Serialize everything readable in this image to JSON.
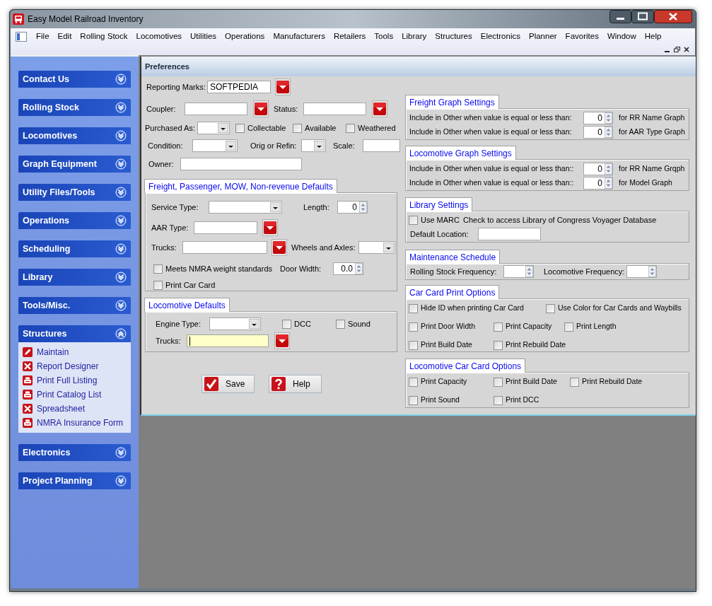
{
  "window": {
    "title": "Easy Model Railroad Inventory"
  },
  "menu": [
    "File",
    "Edit",
    "Rolling Stock",
    "Locomotives",
    "Utilities",
    "Operations",
    "Manufacturers",
    "Retailers",
    "Tools",
    "Library",
    "Structures",
    "Electronics",
    "Planner",
    "Favorites",
    "Window",
    "Help"
  ],
  "sidebar": {
    "groups": [
      {
        "title": "Contact Us",
        "expanded": false
      },
      {
        "title": "Rolling Stock",
        "expanded": false
      },
      {
        "title": "Locomotives",
        "expanded": false
      },
      {
        "title": "Graph Equipment",
        "expanded": false
      },
      {
        "title": "Utility Files/Tools",
        "expanded": false
      },
      {
        "title": "Operations",
        "expanded": false
      },
      {
        "title": "Scheduling",
        "expanded": false
      },
      {
        "title": "Library",
        "expanded": false
      },
      {
        "title": "Tools/Misc.",
        "expanded": false
      },
      {
        "title": "Structures",
        "expanded": true,
        "items": [
          {
            "label": "Maintain",
            "kind": "edit"
          },
          {
            "label": "Report Designer",
            "kind": "tools"
          },
          {
            "label": "Print Full Listing",
            "kind": "print"
          },
          {
            "label": "Print Catalog List",
            "kind": "print"
          },
          {
            "label": "Spreadsheet",
            "kind": "tools"
          },
          {
            "label": "NMRA Insurance Form",
            "kind": "print"
          }
        ]
      },
      {
        "title": "Electronics",
        "expanded": false
      },
      {
        "title": "Project Planning",
        "expanded": false
      }
    ]
  },
  "preferences": {
    "title": "Preferences",
    "reporting_marks": {
      "label": "Reporting Marks:",
      "value": "SOFTPEDIA"
    },
    "coupler": {
      "label": "Coupler:"
    },
    "status": {
      "label": "Status:"
    },
    "purchased_as": {
      "label": "Purchased As:"
    },
    "collectable": {
      "label": "Collectable",
      "checked": false
    },
    "available": {
      "label": "Available",
      "checked": false
    },
    "weathered": {
      "label": "Weathered",
      "checked": false
    },
    "condition": {
      "label": "Condition:"
    },
    "orig_or_refin": {
      "label": "Orig or Refin:"
    },
    "scale": {
      "label": "Scale:"
    },
    "owner": {
      "label": "Owner:"
    },
    "freight_defaults": {
      "title": "Freight, Passenger, MOW, Non-revenue Defaults",
      "service_type": {
        "label": "Service Type:"
      },
      "length": {
        "label": "Length:",
        "value": "0"
      },
      "aar_type": {
        "label": "AAR Type:"
      },
      "trucks": {
        "label": "Trucks:"
      },
      "wheels_and_axles": {
        "label": "Wheels and Axles:"
      },
      "meets_nmra": {
        "label": "Meets NMRA weight standards",
        "checked": false
      },
      "door_width": {
        "label": "Door Width:",
        "value": "0.0"
      },
      "print_car_card": {
        "label": "Print Car Card",
        "checked": false
      }
    },
    "locomotive_defaults": {
      "title": "Locomotive Defaults",
      "engine_type": {
        "label": "Engine Type:"
      },
      "dcc": {
        "label": "DCC",
        "checked": false
      },
      "sound": {
        "label": "Sound",
        "checked": false
      },
      "trucks": {
        "label": "Trucks:",
        "focused": true
      }
    },
    "buttons": [
      {
        "label": "Save",
        "kind": "save"
      },
      {
        "label": "Help",
        "kind": "help"
      }
    ],
    "freight_graph": {
      "title": "Freight Graph Settings",
      "rows": [
        {
          "label": "Include in Other when value is equal or less than:",
          "value": "0",
          "suffix": "for RR Name Graph"
        },
        {
          "label": "Include in Other when value is equal or less than:",
          "value": "0",
          "suffix": "for AAR Type Graph"
        }
      ]
    },
    "locomotive_graph": {
      "title": "Locomotive Graph Settings",
      "rows": [
        {
          "label": "Include in Other when value is equal or less than::",
          "value": "0",
          "suffix": "for RR Name Grqph"
        },
        {
          "label": "Include in Other when value is equal or less than::",
          "value": "0",
          "suffix": "for Model Graph"
        }
      ]
    },
    "library": {
      "title": "Library Settings",
      "use_marc": {
        "label": "Use MARC",
        "checked": false
      },
      "note": "Check to access Library of Congress Voyager Database",
      "default_location": {
        "label": "Default Location:"
      }
    },
    "maintenance": {
      "title": "Maintenance Schedule",
      "rolling_stock": {
        "label": "Rolling Stock Frequency:"
      },
      "locomotive": {
        "label": "Locomotive Frequency:"
      }
    },
    "car_card_options": {
      "title": "Car Card Print Options",
      "options": [
        {
          "label": "Hide ID when printing Car Card",
          "checked": false
        },
        {
          "label": "Use Color for Car Cards and Waybills",
          "checked": false
        },
        {
          "label": "Print Door Width",
          "checked": false
        },
        {
          "label": "Print Capacity",
          "checked": false
        },
        {
          "label": "Print Length",
          "checked": false
        },
        {
          "label": "Print Build Date",
          "checked": false
        },
        {
          "label": "Print Rebuild Date",
          "checked": false
        }
      ]
    },
    "locomotive_card_options": {
      "title": "Locomotive Car Card Options",
      "options": [
        {
          "label": "Print Capacity",
          "checked": false
        },
        {
          "label": "Print Build Date",
          "checked": false
        },
        {
          "label": "Print Rebuild Date",
          "checked": false
        },
        {
          "label": "Print Sound",
          "checked": false
        },
        {
          "label": "Print DCC",
          "checked": false
        }
      ]
    }
  }
}
